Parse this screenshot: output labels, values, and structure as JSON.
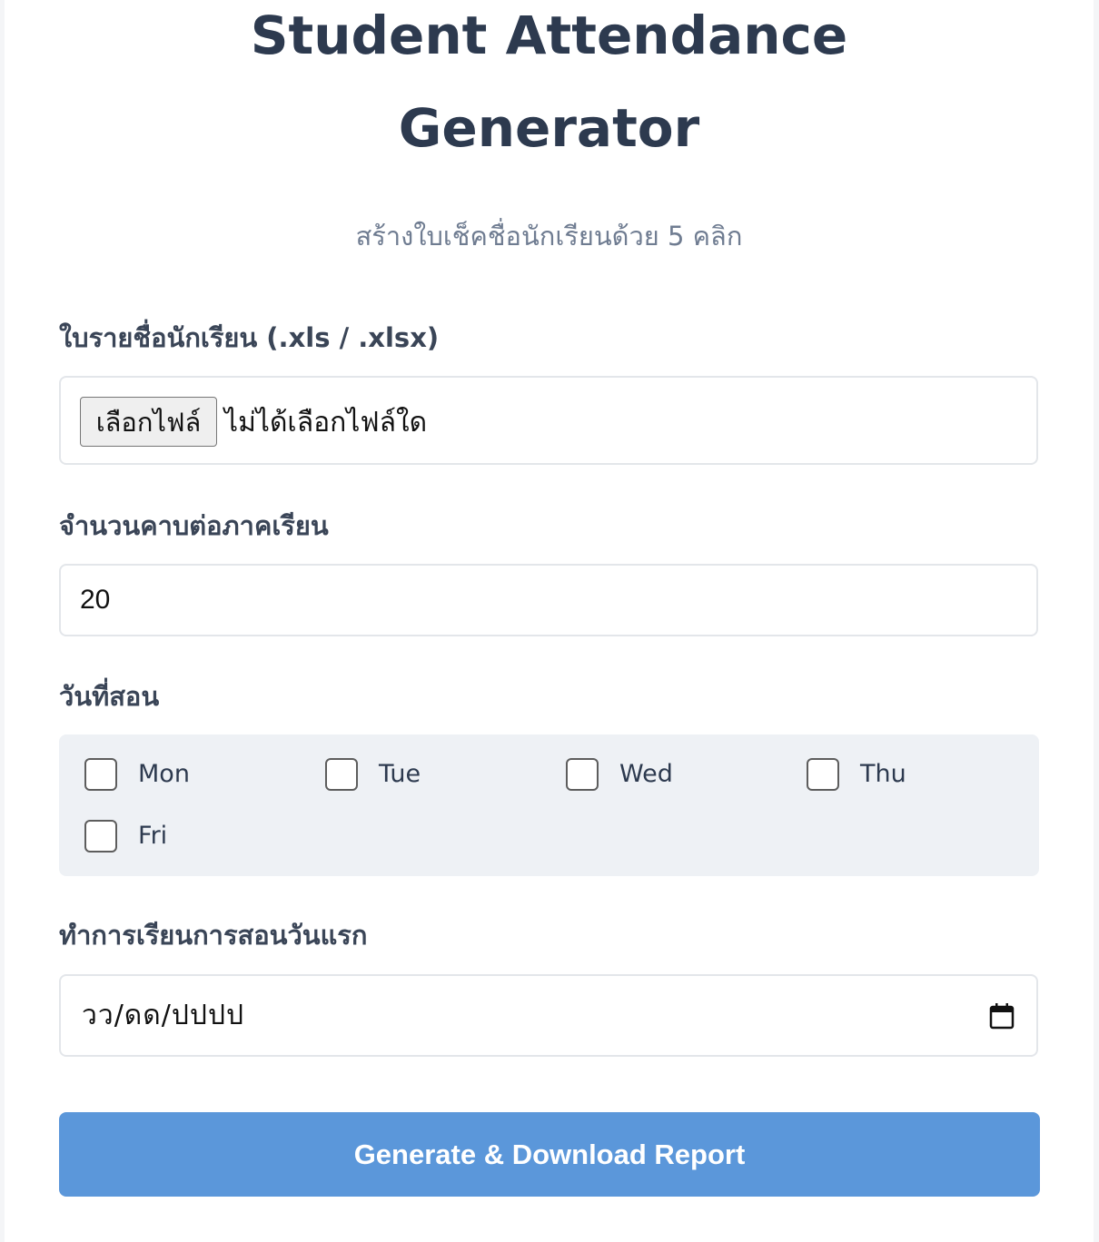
{
  "header": {
    "title_line1": "Student Attendance",
    "title_line2": "Generator",
    "subtitle": "สร้างใบเช็คชื่อนักเรียนด้วย 5 คลิก"
  },
  "file_field": {
    "label": "ใบรายชื่อนักเรียน (.xls / .xlsx)",
    "button_label": "เลือกไฟล์",
    "status": "ไม่ได้เลือกไฟล์ใด"
  },
  "periods_field": {
    "label": "จำนวนคาบต่อภาคเรียน",
    "value": "20"
  },
  "days_field": {
    "label": "วันที่สอน",
    "days": [
      {
        "label": "Mon",
        "checked": false
      },
      {
        "label": "Tue",
        "checked": false
      },
      {
        "label": "Wed",
        "checked": false
      },
      {
        "label": "Thu",
        "checked": false
      },
      {
        "label": "Fri",
        "checked": false
      }
    ]
  },
  "start_date_field": {
    "label": "ทำการเรียนการสอนวันแรก",
    "placeholder": "วว/ดด/ปปปป",
    "icon": "calendar-icon"
  },
  "actions": {
    "generate_label": "Generate & Download Report"
  },
  "colors": {
    "primary_button": "#5b97da",
    "title_text": "#2d3a4f",
    "subtitle_text": "#6f7c91",
    "days_panel_bg": "#eef1f5"
  }
}
